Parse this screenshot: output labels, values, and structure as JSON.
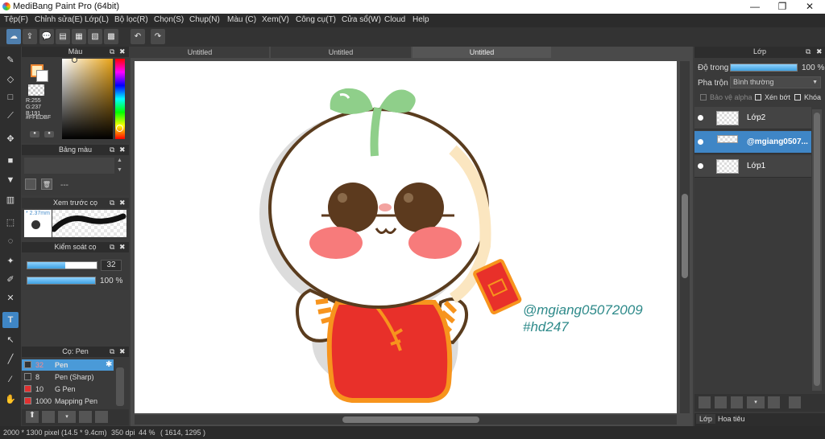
{
  "window": {
    "title": "MediBang Paint Pro (64bit)",
    "minimize": "—",
    "maximize": "❐",
    "close": "✕"
  },
  "menu": [
    "Tệp(F)",
    "Chỉnh sửa(E)",
    "Lớp(L)",
    "Bộ lọc(R)",
    "Chọn(S)",
    "Chụp(N)",
    "Màu (C)",
    "Xem(V)",
    "Công cụ(T)",
    "Cửa sổ(W)",
    "Cloud",
    "Help"
  ],
  "color_panel": {
    "title": "Màu",
    "r": "R:255",
    "g": "G:237",
    "b": "B:191",
    "hex": "#FFEDBF",
    "fg": "#ffedbf"
  },
  "palette_panel": {
    "title": "Bảng màu",
    "dashes": "---"
  },
  "brush_preview": {
    "title": "Xem trước cọ",
    "size": "* 2.37mm"
  },
  "brush_control": {
    "title": "Kiểm soát cọ",
    "size_value": "32",
    "opacity_value": "100 %",
    "size_level": 0.55,
    "opacity_level": 1.0
  },
  "brush_list": {
    "title": "Cọ: Pen",
    "items": [
      {
        "size": "32",
        "name": "Pen",
        "color": "#333333",
        "selected": true
      },
      {
        "size": "8",
        "name": "Pen (Sharp)",
        "color": "#333333",
        "selected": false
      },
      {
        "size": "10",
        "name": "G Pen",
        "color": "#e03030",
        "selected": false
      },
      {
        "size": "1000",
        "name": "Mapping Pen",
        "color": "#e03030",
        "selected": false
      }
    ]
  },
  "tabs": [
    "Untitled",
    "Untitled",
    "Untitled"
  ],
  "artwork": {
    "handle": "@mgiang05072009",
    "hashtag": "#hd247"
  },
  "layer_panel": {
    "title": "Lớp",
    "opacity_label": "Độ trong",
    "opacity_value": "100 %",
    "opacity_level": 1.0,
    "blend_label": "Pha trộn",
    "blend_value": "Bình thường",
    "protect_alpha": "Bảo vệ alpha",
    "clipping": "Xén bớt",
    "lock": "Khóa",
    "layers": [
      {
        "name": "Lớp2",
        "selected": false
      },
      {
        "name": "@mgiang0507...",
        "selected": true
      },
      {
        "name": "Lớp1",
        "selected": false
      }
    ],
    "bottom_tabs": [
      "Lớp",
      "Hoa tiêu"
    ]
  },
  "status": {
    "dims": "2000 * 1300 pixel",
    "size_cm": "(14.5 * 9.4cm)",
    "dpi": "350 dpi",
    "zoom": "44 %",
    "coords": "( 1614, 1295 )"
  },
  "colors": {
    "accent": "#4a9ad8",
    "selection": "#3f86c6",
    "red": "#e8302a",
    "orange": "#f7941d",
    "leaf": "#8fcf8a"
  }
}
